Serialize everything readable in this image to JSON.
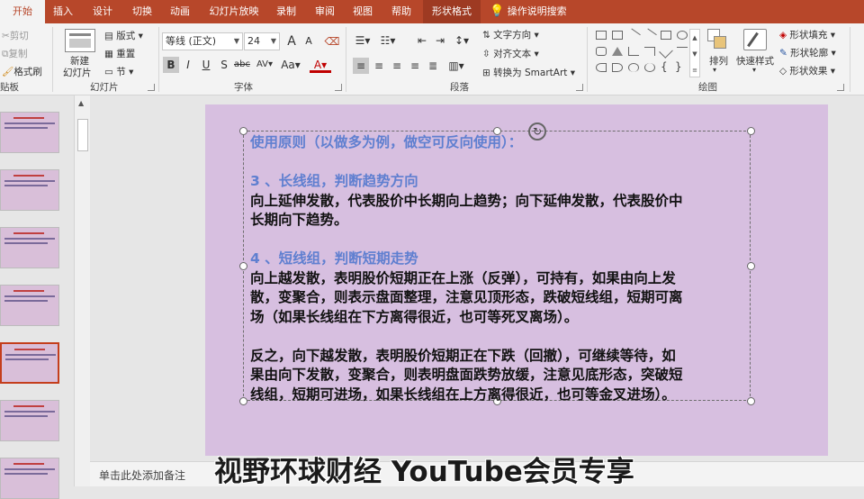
{
  "tabs": [
    {
      "label": "开始",
      "active": true
    },
    {
      "label": "插入"
    },
    {
      "label": "设计"
    },
    {
      "label": "切换"
    },
    {
      "label": "动画"
    },
    {
      "label": "幻灯片放映"
    },
    {
      "label": "录制"
    },
    {
      "label": "审阅"
    },
    {
      "label": "视图"
    },
    {
      "label": "帮助"
    },
    {
      "label": "形状格式",
      "contextual": true
    },
    {
      "label": "操作说明搜索",
      "icon": "lightbulb-icon"
    }
  ],
  "ribbon": {
    "clipboard": {
      "cut": "剪切",
      "copy": "复制",
      "format_painter": "格式刷",
      "label": "贴板"
    },
    "slides": {
      "new_slide_line1": "新建",
      "new_slide_line2": "幻灯片",
      "layout": "版式",
      "reset": "重置",
      "section": "节",
      "label": "幻灯片"
    },
    "font": {
      "font_name": "等线 (正文)",
      "font_size": "24",
      "bold": "B",
      "italic": "I",
      "underline": "U",
      "shadow": "S",
      "strike": "abc",
      "spacing": "AV",
      "case": "Aa",
      "color": "A",
      "grow": "A",
      "shrink": "A",
      "label": "字体"
    },
    "paragraph": {
      "text_direction": "文字方向",
      "align_text": "对齐文本",
      "smartart": "转换为 SmartArt",
      "label": "段落"
    },
    "drawing": {
      "arrange": "排列",
      "quick_styles": "快速样式",
      "shape_fill": "形状填充",
      "shape_outline": "形状轮廓",
      "shape_effects": "形状效果",
      "label": "绘图"
    }
  },
  "slide": {
    "lines": [
      {
        "text": "使用原则（以做多为例，做空可反向使用）：",
        "style": "blue"
      },
      {
        "text": "",
        "style": "blank"
      },
      {
        "text": "3 、长线组，判断趋势方向",
        "style": "blue"
      },
      {
        "text": "向上延伸发散，代表股价中长期向上趋势；向下延伸发散，代表股价中",
        "style": "body"
      },
      {
        "text": "长期向下趋势。",
        "style": "body"
      },
      {
        "text": "",
        "style": "blank"
      },
      {
        "text": "4 、短线组，判断短期走势",
        "style": "blue"
      },
      {
        "text": "向上越发散，表明股价短期正在上涨（反弹），可持有，如果由向上发",
        "style": "body"
      },
      {
        "text": "散，变聚合，则表示盘面整理，注意见顶形态，跌破短线组，短期可离",
        "style": "body"
      },
      {
        "text": "场（如果长线组在下方离得很近，也可等死叉离场）。",
        "style": "body"
      },
      {
        "text": "",
        "style": "blank"
      },
      {
        "text": "反之，向下越发散，表明股价短期正在下跌（回撤），可继续等待，如",
        "style": "body"
      },
      {
        "text": "果由向下发散，变聚合，则表明盘面跌势放缓，注意见底形态，突破短",
        "style": "body"
      },
      {
        "text": "线组，短期可进场，如果长线组在上方离得很近，也可等金叉进场）。",
        "style": "body"
      }
    ]
  },
  "thumbnails": [
    {
      "selected": false
    },
    {
      "selected": false
    },
    {
      "selected": false
    },
    {
      "selected": false
    },
    {
      "selected": true
    },
    {
      "selected": false
    },
    {
      "selected": false
    }
  ],
  "notes_placeholder": "单击此处添加备注",
  "watermark": "视野环球财经 YouTube会员专享",
  "colors": {
    "accent": "#b7472a",
    "slide_bg": "#d7bfe0",
    "heading_blue": "#5f7fd0"
  }
}
